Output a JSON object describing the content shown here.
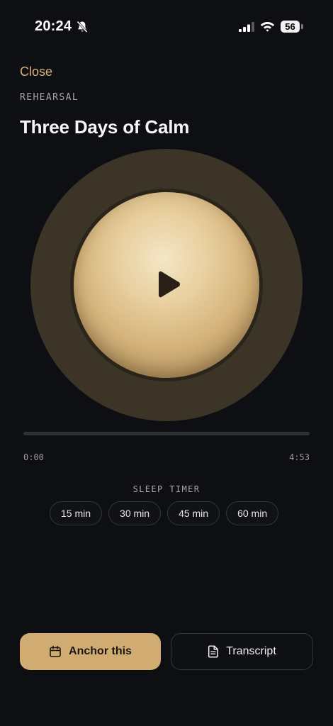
{
  "status_bar": {
    "time": "20:24",
    "battery": "56"
  },
  "header": {
    "close_label": "Close",
    "eyebrow": "REHEARSAL",
    "title": "Three Days of Calm"
  },
  "player": {
    "elapsed": "0:00",
    "total": "4:53",
    "progress_fraction": 0
  },
  "sleep_timer": {
    "label": "SLEEP TIMER",
    "options": [
      "15 min",
      "30 min",
      "45 min",
      "60 min"
    ]
  },
  "actions": {
    "anchor_label": "Anchor this",
    "transcript_label": "Transcript"
  },
  "colors": {
    "accent": "#d0ab72",
    "background": "#0e0f12"
  },
  "icons": {
    "status": [
      "bell-slash-icon",
      "cellular-signal-icon",
      "wifi-icon",
      "battery-icon"
    ],
    "player": "play-icon",
    "anchor": "calendar-icon",
    "transcript": "document-icon"
  }
}
